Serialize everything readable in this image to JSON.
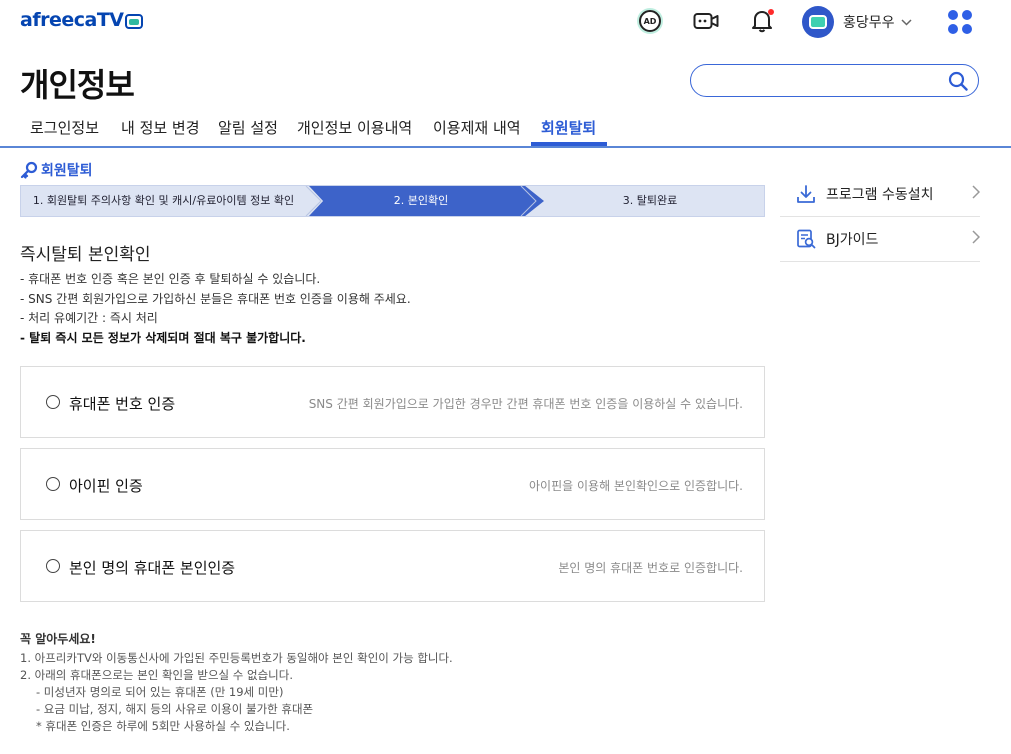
{
  "header": {
    "logo_text": "afreecaTV",
    "user_name": "홍당무우",
    "ad_label": "AD"
  },
  "page": {
    "title": "개인정보",
    "search_placeholder": ""
  },
  "tabs": [
    {
      "label": "로그인정보",
      "active": false
    },
    {
      "label": "내 정보 변경",
      "active": false
    },
    {
      "label": "알림 설정",
      "active": false
    },
    {
      "label": "개인정보 이용내역",
      "active": false
    },
    {
      "label": "이용제재 내역",
      "active": false
    },
    {
      "label": "회원탈퇴",
      "active": true
    }
  ],
  "section": {
    "title": "회원탈퇴"
  },
  "steps": [
    {
      "label": "1. 회원탈퇴  주의사항 확인 및 캐시/유료아이템 정보 확인",
      "active": false
    },
    {
      "label": "2. 본인확인",
      "active": true
    },
    {
      "label": "3. 탈퇴완료",
      "active": false
    }
  ],
  "instructions": {
    "title": "즉시탈퇴 본인확인",
    "lines": [
      "- 휴대폰 번호 인증 혹은 본인 인증 후 탈퇴하실 수 있습니다.",
      "- SNS 간편 회원가입으로 가입하신 분들은 휴대폰 번호 인증을 이용해 주세요.",
      "- 처리 유예기간 : 즉시 처리"
    ],
    "warning": "- 탈퇴 즉시 모든 정보가 삭제되며 절대 복구 불가합니다."
  },
  "options": [
    {
      "label": "휴대폰 번호 인증",
      "desc": "SNS 간편 회원가입으로 가입한 경우만 간편 휴대폰 번호 인증을 이용하실 수 있습니다."
    },
    {
      "label": "아이핀 인증",
      "desc": "아이핀을 이용해 본인확인으로 인증합니다."
    },
    {
      "label": "본인 명의 휴대폰 본인인증",
      "desc": "본인 명의 휴대폰 번호로 인증합니다."
    }
  ],
  "notes": {
    "title": "꼭 알아두세요!",
    "lines": [
      "1. 아프리카TV와 이동통신사에 가입된 주민등록번호가 동일해야 본인 확인이 가능 합니다.",
      "2. 아래의 휴대폰으로는 본인 확인을 받으실 수 없습니다."
    ],
    "sub_lines": [
      "- 미성년자 명의로 되어 있는 휴대폰 (만 19세 미만)",
      "- 요금 미납, 정지, 해지 등의 사유로 이용이 불가한 휴대폰",
      "* 휴대폰 인증은 하루에 5회만 사용하실 수 있습니다."
    ]
  },
  "sidebar": {
    "items": [
      {
        "label": "프로그램 수동설치",
        "icon": "download-icon"
      },
      {
        "label": "BJ가이드",
        "icon": "guide-search-icon"
      }
    ]
  }
}
